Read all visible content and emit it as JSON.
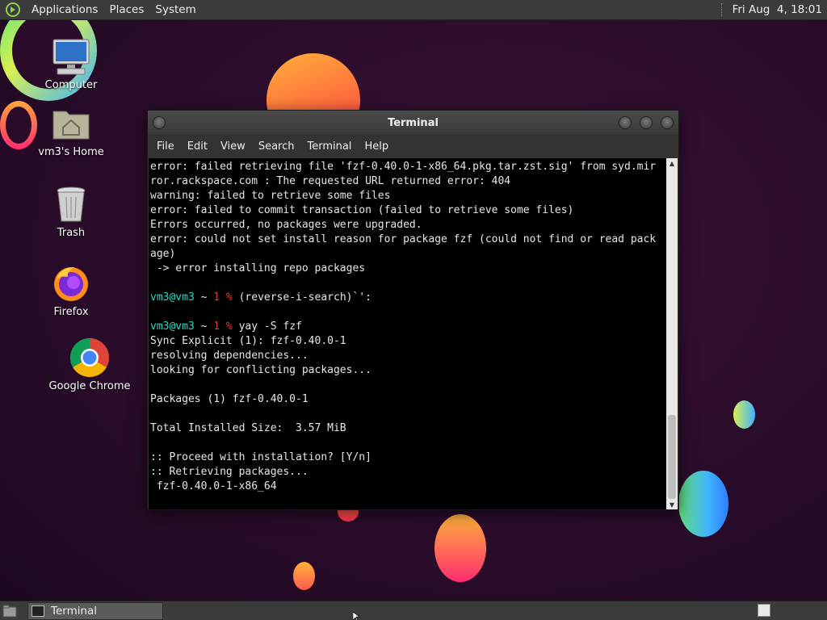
{
  "top_panel": {
    "menus": [
      "Applications",
      "Places",
      "System"
    ],
    "clock": "Fri Aug  4, 18:01"
  },
  "desktop_icons": [
    {
      "label": "Computer",
      "icon": "computer-icon"
    },
    {
      "label": "vm3's Home",
      "icon": "home-folder-icon"
    },
    {
      "label": "Trash",
      "icon": "trash-icon"
    },
    {
      "label": "Firefox",
      "icon": "firefox-icon"
    },
    {
      "label": "Google Chrome",
      "icon": "chrome-icon"
    }
  ],
  "terminal_window": {
    "title": "Terminal",
    "menu": [
      "File",
      "Edit",
      "View",
      "Search",
      "Terminal",
      "Help"
    ],
    "lines": [
      "error: failed retrieving file 'fzf-0.40.0-1-x86_64.pkg.tar.zst.sig' from syd.mir",
      "ror.rackspace.com : The requested URL returned error: 404",
      "warning: failed to retrieve some files",
      "error: failed to commit transaction (failed to retrieve some files)",
      "Errors occurred, no packages were upgraded.",
      "error: could not set install reason for package fzf (could not find or read pack",
      "age)",
      " -> error installing repo packages",
      "",
      "__PROMPT__ (reverse-i-search)`':",
      "",
      "__PROMPT__ yay -S fzf",
      "Sync Explicit (1): fzf-0.40.0-1",
      "resolving dependencies...",
      "looking for conflicting packages...",
      "",
      "Packages (1) fzf-0.40.0-1",
      "",
      "Total Installed Size:  3.57 MiB",
      "",
      ":: Proceed with installation? [Y/n]",
      ":: Retrieving packages...",
      " fzf-0.40.0-1-x86_64"
    ],
    "prompt": {
      "user": "vm3@vm3",
      "path": "~",
      "status": "1",
      "symbol": "%"
    }
  },
  "bottom_panel": {
    "task_label": "Terminal"
  },
  "colors": {
    "prompt_user": "#2fd6c0",
    "prompt_status": "#d83b3b"
  }
}
